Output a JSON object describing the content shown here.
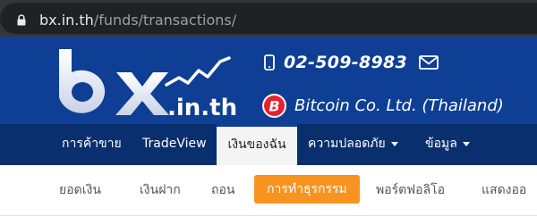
{
  "browser": {
    "url_host": "bx.in.th",
    "url_path": "/funds/transactions/"
  },
  "header": {
    "logo_text": "bx.in.th",
    "phone": "02-509-8983",
    "company": "Bitcoin Co. Ltd. (Thailand)"
  },
  "nav": {
    "items": [
      {
        "label": "การค้าขาย",
        "dropdown": false,
        "active": false
      },
      {
        "label": "TradeView",
        "dropdown": false,
        "active": false
      },
      {
        "label": "เงินของฉัน",
        "dropdown": false,
        "active": true
      },
      {
        "label": "ความปลอดภัย",
        "dropdown": true,
        "active": false
      },
      {
        "label": "ข้อมูล",
        "dropdown": true,
        "active": false
      }
    ]
  },
  "subnav": {
    "items": [
      {
        "label": "ยอดเงิน",
        "active": false
      },
      {
        "label": "เงินฝาก",
        "active": false
      },
      {
        "label": "ถอน",
        "active": false
      },
      {
        "label": "การทำธุรกรรม",
        "active": true
      },
      {
        "label": "พอร์ตฟอลิโอ",
        "active": false
      },
      {
        "label": "แสดงออ",
        "active": false
      }
    ]
  },
  "colors": {
    "header_bg": "#0e3f95",
    "nav_bg": "#0a2f6f",
    "accent": "#f7931e",
    "bitcoin_red": "#e8212e"
  },
  "icons": [
    "lock-icon",
    "phone-icon",
    "mail-icon",
    "bitcoin-icon",
    "chevron-down-icon"
  ]
}
